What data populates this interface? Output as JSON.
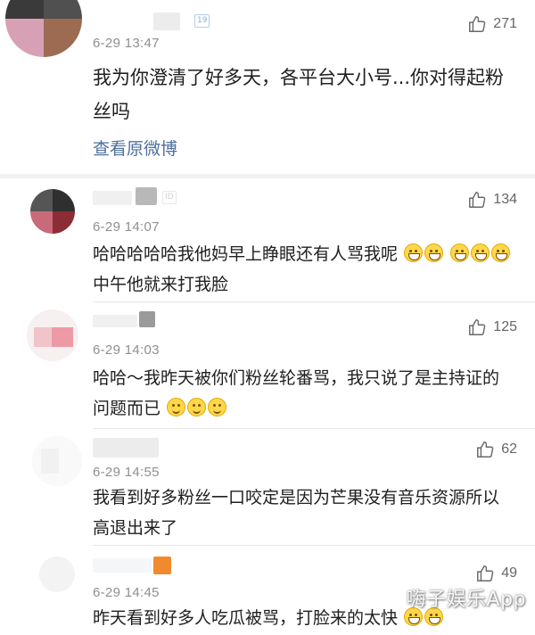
{
  "post": {
    "time": "6-29 13:47",
    "likes": "271",
    "text": "我为你澄清了好多天，各平台大小号...你对得起粉丝吗",
    "view_original_label": "查看原微博",
    "badge": "19"
  },
  "comments": [
    {
      "time": "6-29 14:07",
      "likes": "134",
      "text": "哈哈哈哈哈我他妈早上睁眼还有人骂我呢",
      "text_after_emoji": "中午他就来打我脸",
      "badge": "ID"
    },
    {
      "time": "6-29 14:03",
      "likes": "125",
      "text": "哈哈～我昨天被你们粉丝轮番骂，我只说了是主持证的问题而已"
    },
    {
      "time": "6-29 14:55",
      "likes": "62",
      "text": "我看到好多粉丝一口咬定是因为芒果没有音乐资源所以高退出来了"
    },
    {
      "time": "6-29 14:45",
      "likes": "49",
      "text": "昨天看到好多人吃瓜被骂，打脸来的太快"
    }
  ],
  "watermark": "嗨子娱乐App",
  "icons": {
    "like": "thumbs-up-icon",
    "emoji_grin": "grinning-face-icon",
    "emoji_smile": "smiling-face-icon",
    "emoji_laugh": "laughing-face-icon"
  },
  "colors": {
    "link": "#4d6f9e",
    "meta": "#8f8f8f",
    "divider": "#e6e6e6"
  }
}
